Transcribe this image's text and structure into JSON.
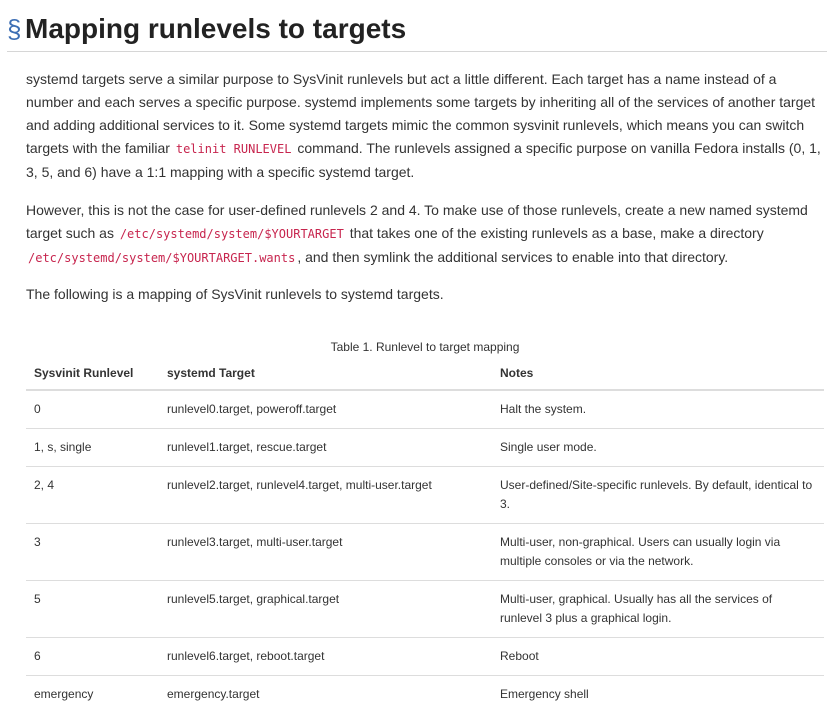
{
  "section": {
    "anchor": "§",
    "title": "Mapping runlevels to targets"
  },
  "intro": {
    "p1_a": "systemd targets serve a similar purpose to SysVinit runlevels but act a little different. Each target has a name instead of a number and each serves a specific purpose. systemd implements some targets by inheriting all of the services of another target and adding additional services to it. Some systemd targets mimic the common sysvinit runlevels, which means you can switch targets with the familiar",
    "p1_code": "telinit RUNLEVEL",
    "p1_b": "command. The runlevels assigned a specific purpose on vanilla Fedora installs (0, 1, 3, 5, and 6) have a 1:1 mapping with a specific systemd target.",
    "p2_a": "However, this is not the case for user-defined runlevels 2 and 4. To make use of those runlevels, create a new named systemd target such as",
    "p2_code1": "/etc/systemd/system/$YOURTARGET",
    "p2_b": "that takes one of the existing runlevels as a base, make a directory",
    "p2_code2": "/etc/systemd/system/$YOURTARGET.wants",
    "p2_c": ", and then symlink the additional services to enable into that directory.",
    "p3": "The following is a mapping of SysVinit runlevels to systemd targets."
  },
  "table": {
    "caption": "Table 1. Runlevel to target mapping",
    "headers": [
      "Sysvinit Runlevel",
      "systemd Target",
      "Notes"
    ],
    "rows": [
      [
        "0",
        "runlevel0.target, poweroff.target",
        "Halt the system."
      ],
      [
        "1, s, single",
        "runlevel1.target, rescue.target",
        "Single user mode."
      ],
      [
        "2, 4",
        "runlevel2.target, runlevel4.target, multi-user.target",
        "User-defined/Site-specific runlevels. By default, identical to 3."
      ],
      [
        "3",
        "runlevel3.target, multi-user.target",
        "Multi-user, non-graphical. Users can usually login via multiple consoles or via the network."
      ],
      [
        "5",
        "runlevel5.target, graphical.target",
        "Multi-user, graphical. Usually has all the services of runlevel 3 plus a graphical login."
      ],
      [
        "6",
        "runlevel6.target, reboot.target",
        "Reboot"
      ],
      [
        "emergency",
        "emergency.target",
        "Emergency shell"
      ]
    ]
  },
  "colors": {
    "anchor": "#3c6eb4",
    "code": "#c7254e",
    "text": "#333333",
    "rule": "#dddddd"
  }
}
